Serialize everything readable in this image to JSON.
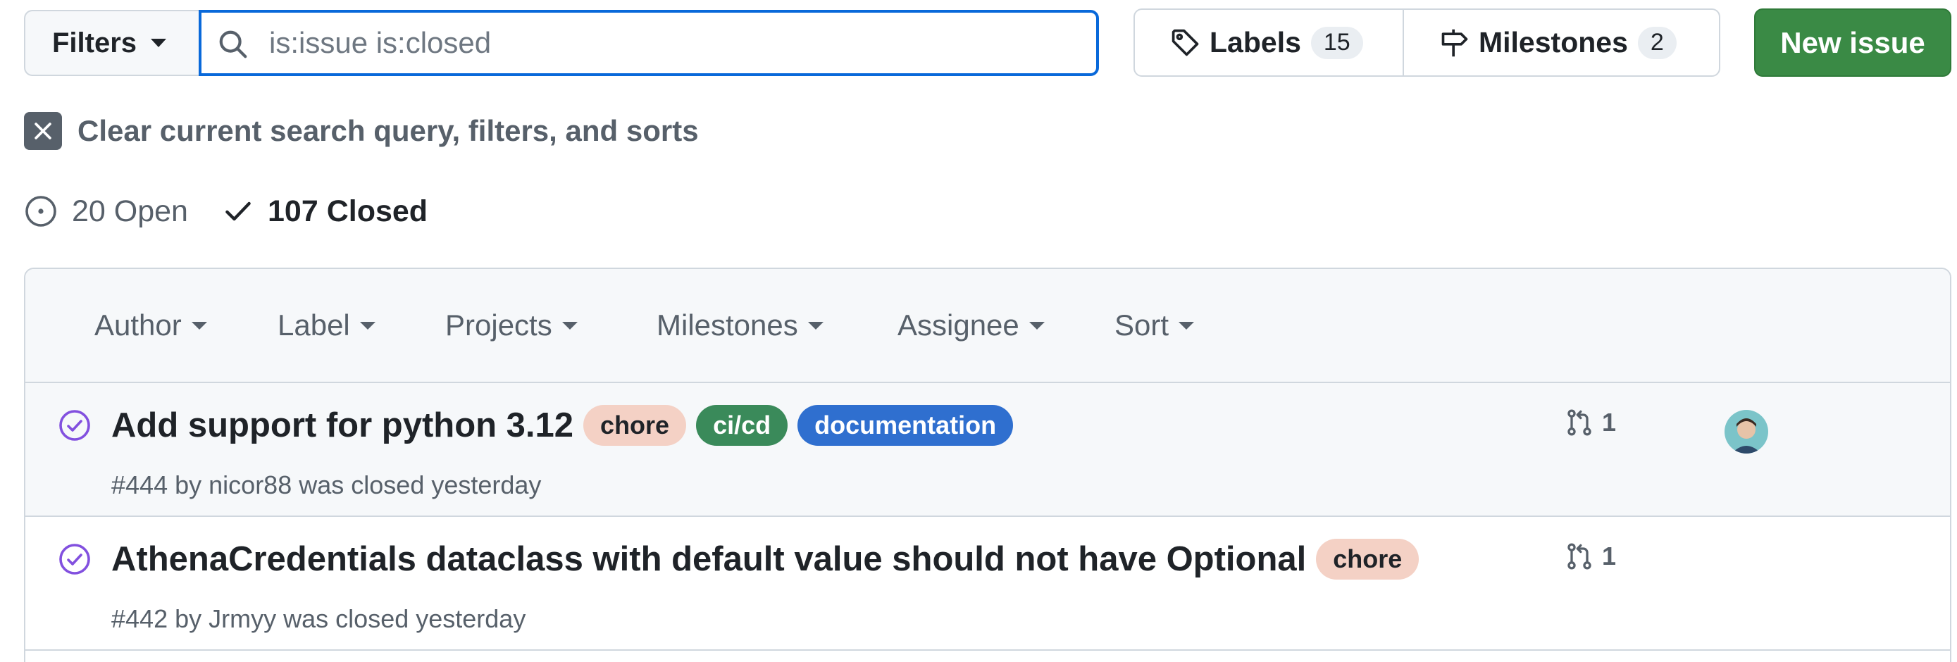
{
  "toolbar": {
    "filters_label": "Filters",
    "search_placeholder": "is:issue is:closed",
    "search_value": "",
    "labels_label": "Labels",
    "labels_count": "15",
    "milestones_label": "Milestones",
    "milestones_count": "2",
    "new_issue_label": "New issue"
  },
  "clear_query": "Clear current search query, filters, and sorts",
  "states": {
    "open": "20 Open",
    "closed": "107 Closed"
  },
  "table_filters": {
    "author": "Author",
    "label": "Label",
    "projects": "Projects",
    "milestones": "Milestones",
    "assignee": "Assignee",
    "sort": "Sort"
  },
  "issues": [
    {
      "title": "Add support for python 3.12",
      "labels": [
        {
          "name": "chore",
          "bg": "#f4d1c5",
          "fg": "#1f2328"
        },
        {
          "name": "ci/cd",
          "bg": "#3a8a5a",
          "fg": "#ffffff"
        },
        {
          "name": "documentation",
          "bg": "#2f6fcf",
          "fg": "#ffffff"
        }
      ],
      "number": "#444",
      "by": "by",
      "author": "nicor88",
      "closed_text": "was closed yesterday",
      "linked_prs": "1"
    },
    {
      "title": "AthenaCredentials dataclass with default value should not have Optional",
      "labels": [
        {
          "name": "chore",
          "bg": "#f4d1c5",
          "fg": "#1f2328"
        }
      ],
      "number": "#442",
      "by": "by",
      "author": "Jrmyy",
      "closed_text": "was closed yesterday",
      "linked_prs": "1"
    }
  ],
  "colors": {
    "accent": "#0969da",
    "primary_button": "#3a8a45",
    "closed_icon": "#8250df"
  }
}
